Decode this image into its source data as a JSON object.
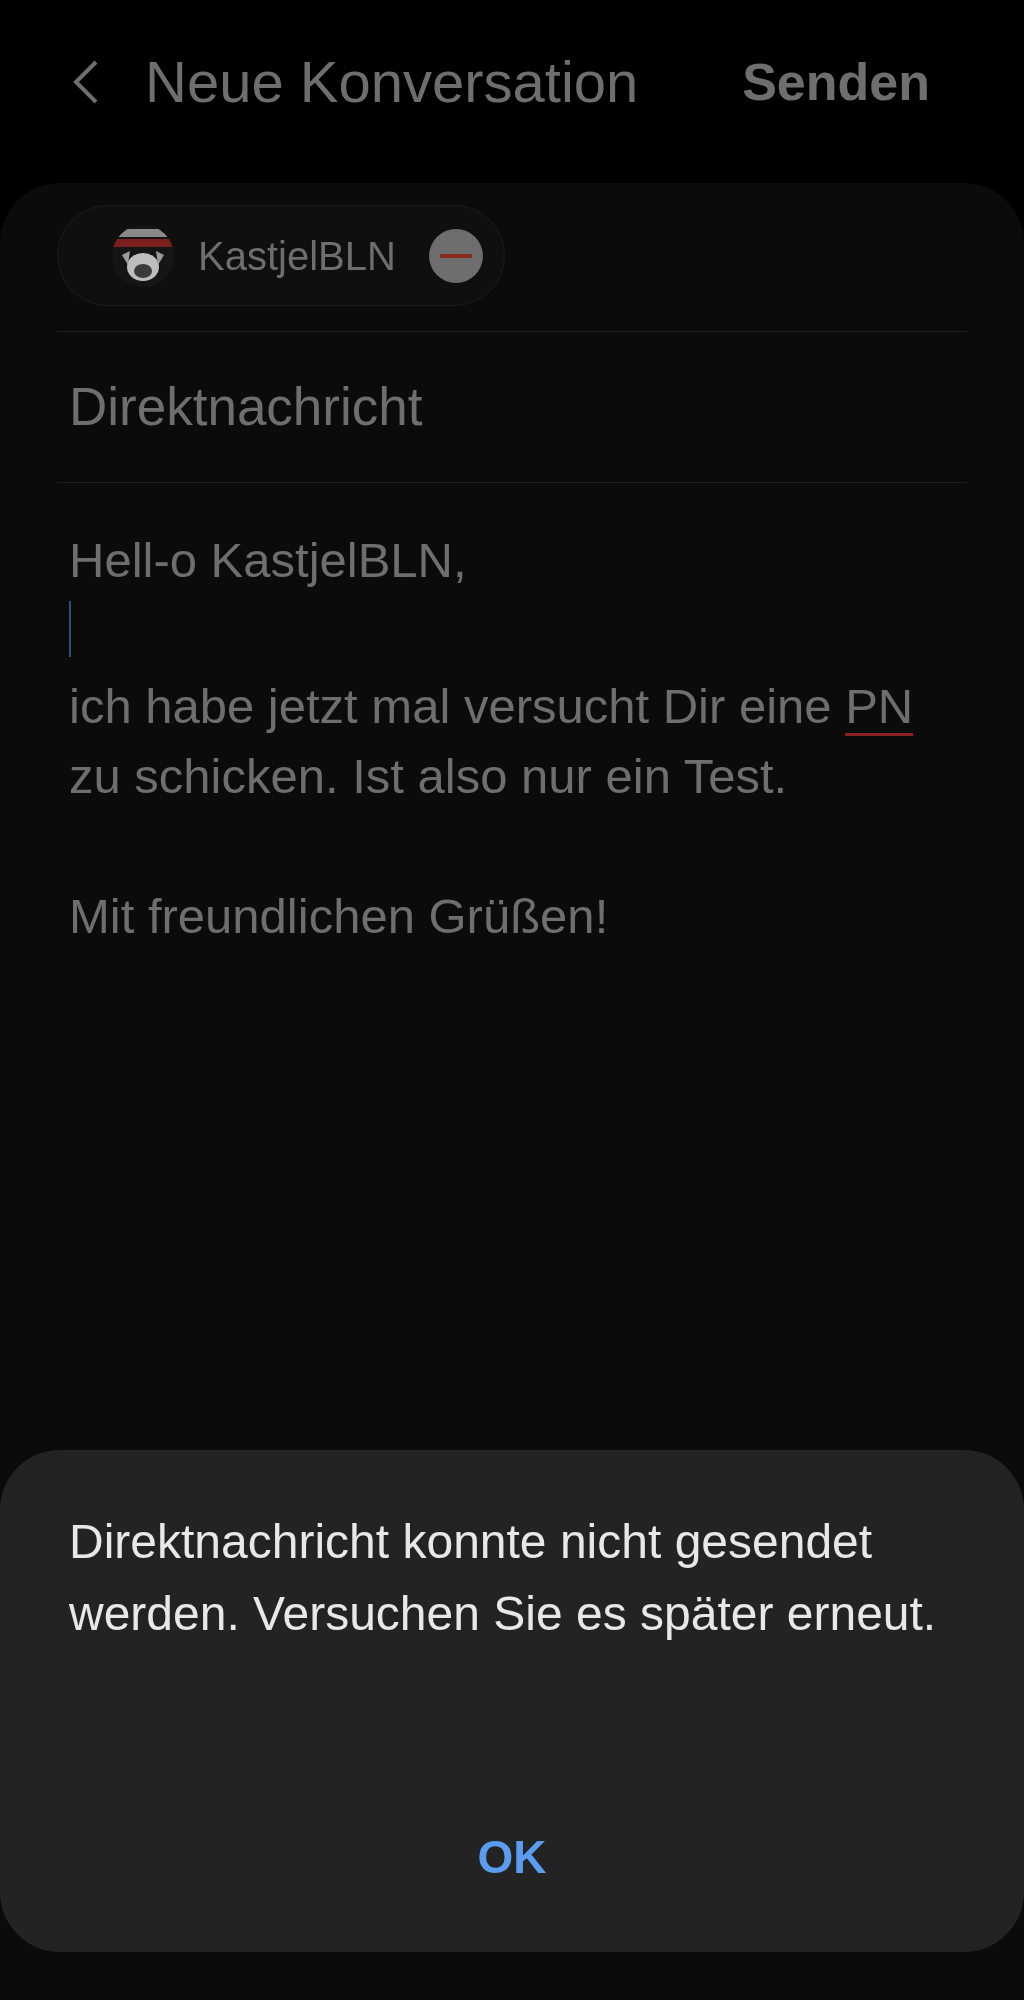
{
  "header": {
    "title": "Neue Konversation",
    "action": "Senden"
  },
  "recipients": [
    {
      "name": "KastjelBLN"
    }
  ],
  "subject": {
    "value": "Direktnachricht"
  },
  "body": {
    "lines": [
      {
        "kind": "text",
        "segments": [
          {
            "text": "Hell-o KastjelBLN,",
            "misspelled": false
          }
        ]
      },
      {
        "kind": "cursor"
      },
      {
        "kind": "text",
        "segments": [
          {
            "text": "ich habe jetzt mal versucht Dir eine ",
            "misspelled": false
          },
          {
            "text": "PN",
            "misspelled": true
          }
        ]
      },
      {
        "kind": "text",
        "segments": [
          {
            "text": "zu schicken. Ist also nur ein Test.",
            "misspelled": false
          }
        ]
      },
      {
        "kind": "blank"
      },
      {
        "kind": "text",
        "segments": [
          {
            "text": "Mit freundlichen Grüßen!",
            "misspelled": false
          }
        ]
      }
    ]
  },
  "dialog": {
    "message": "Direktnachricht konnte nicht gesendet werden. Versuchen Sie es später erneut.",
    "button": "OK"
  }
}
